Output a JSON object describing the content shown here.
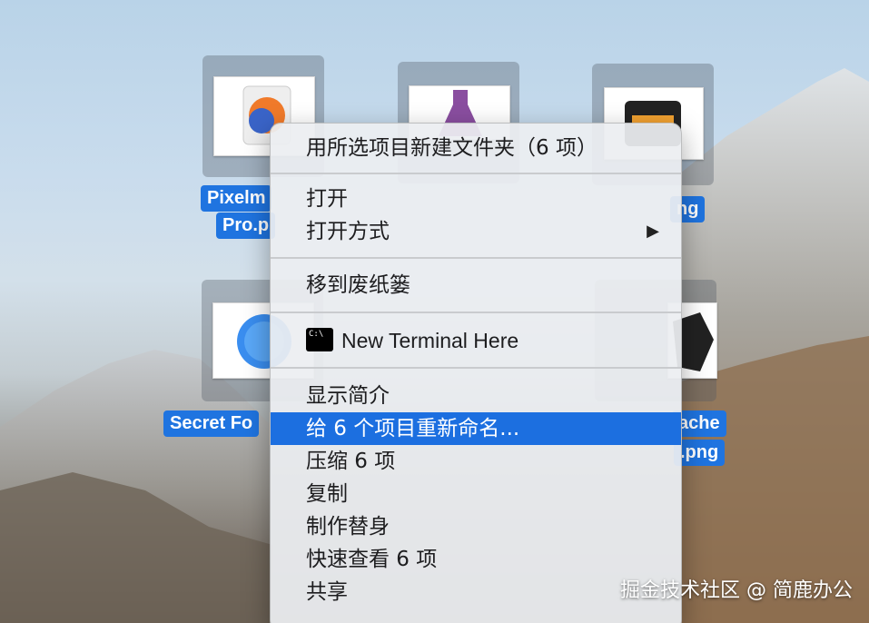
{
  "desktop": {
    "files": [
      {
        "label_line1": "PixelmatorPro.png",
        "visible_line1": "Pixelm",
        "visible_line2": "Pro.p"
      },
      {
        "label_line1": "ng"
      },
      {
        "label_line1": "Secret Fo"
      },
      {
        "label_line1": "ache",
        "label_line2": ".png"
      }
    ]
  },
  "menu": {
    "new_folder": "用所选项目新建文件夹（6 项）",
    "open": "打开",
    "open_with": "打开方式",
    "open_with_arrow": "▶",
    "trash": "移到废纸篓",
    "terminal_icon_text": "C:\\",
    "new_terminal": "New Terminal Here",
    "get_info": "显示简介",
    "rename": "给 6 个项目重新命名...",
    "compress": "压缩 6 项",
    "duplicate": "复制",
    "make_alias": "制作替身",
    "quick_look": "快速查看 6 项",
    "share": "共享"
  },
  "watermark": "掘金技术社区 @ 简鹿办公",
  "colors": {
    "highlight": "#1c6fe0",
    "label_bg": "#1f74e0"
  }
}
